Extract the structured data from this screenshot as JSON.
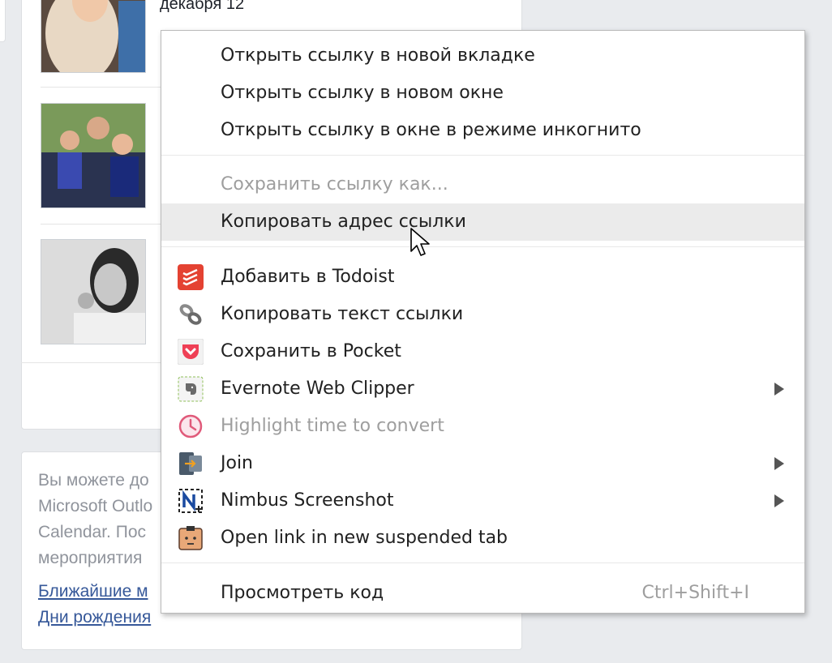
{
  "background": {
    "date_text": "декабря 12",
    "info_lines": [
      "Вы можете до",
      "Microsoft Outlo",
      "Calendar. Пос",
      "мероприятия"
    ],
    "links": [
      "Ближайшие м",
      "Дни рождения"
    ]
  },
  "menu": {
    "items": [
      {
        "label": "Открыть ссылку в новой вкладке"
      },
      {
        "label": "Открыть ссылку в новом окне"
      },
      {
        "label": "Открыть ссылку в окне в режиме инкогнито"
      },
      {
        "label": "Сохранить ссылку как..."
      },
      {
        "label": "Копировать адрес ссылки"
      },
      {
        "label": "Добавить в Todoist",
        "icon": "todoist-icon"
      },
      {
        "label": "Копировать текст ссылки",
        "icon": "link-chain-icon"
      },
      {
        "label": "Сохранить в Pocket",
        "icon": "pocket-icon"
      },
      {
        "label": "Evernote Web Clipper",
        "icon": "evernote-icon"
      },
      {
        "label": "Highlight time to convert",
        "icon": "clock-icon"
      },
      {
        "label": "Join",
        "icon": "join-icon"
      },
      {
        "label": "Nimbus Screenshot",
        "icon": "nimbus-icon"
      },
      {
        "label": "Open link in new suspended tab",
        "icon": "suspender-icon"
      },
      {
        "label": "Просмотреть код",
        "shortcut": "Ctrl+Shift+I"
      }
    ]
  },
  "colors": {
    "link": "#365899",
    "highlight": "#ebebeb",
    "todoist": "#e44232",
    "pocket": "#ef4056",
    "clock": "#e05a7a"
  }
}
